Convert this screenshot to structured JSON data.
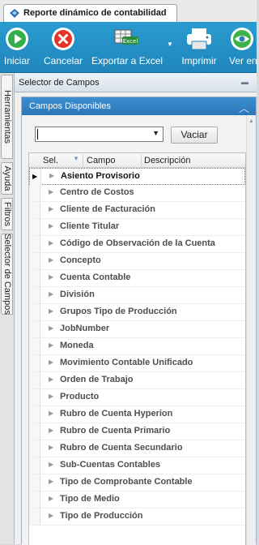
{
  "window": {
    "tab_title": "Reporte dinámico de contabilidad"
  },
  "toolbar": {
    "iniciar": "Iniciar",
    "cancelar": "Cancelar",
    "exportar": "Exportar a Excel",
    "excel_badge": "Excel",
    "imprimir": "Imprimir",
    "ver": "Ver en"
  },
  "left_tabs": [
    "Herramientas",
    "Ayuda",
    "Filtros",
    "Selector de Campos"
  ],
  "panel": {
    "title": "Selector de Campos",
    "pin_glyph": "▬"
  },
  "group": {
    "title": "Campos Disponibles"
  },
  "search": {
    "value": "",
    "button": "Vaciar"
  },
  "grid": {
    "columns": [
      "Sel.",
      "Campo",
      "Descripción"
    ],
    "rows": [
      "Asiento Provisorio",
      "Centro de Costos",
      "Cliente de Facturación",
      "Cliente Titular",
      "Código de Observación de la Cuenta",
      "Concepto",
      "Cuenta Contable",
      "División",
      "Grupos Tipo de Producción",
      "JobNumber",
      "Moneda",
      "Movimiento Contable Unificado",
      "Orden de Trabajo",
      "Producto",
      "Rubro de Cuenta Hyperion",
      "Rubro de Cuenta Primario",
      "Rubro de Cuenta Secundario",
      "Sub-Cuentas Contables",
      "Tipo de Comprobante Contable",
      "Tipo de Medio",
      "Tipo de Producción"
    ],
    "selected_index": 0
  },
  "colors": {
    "toolbar": "#2a9bd0",
    "group_header": "#3d8fd0"
  }
}
